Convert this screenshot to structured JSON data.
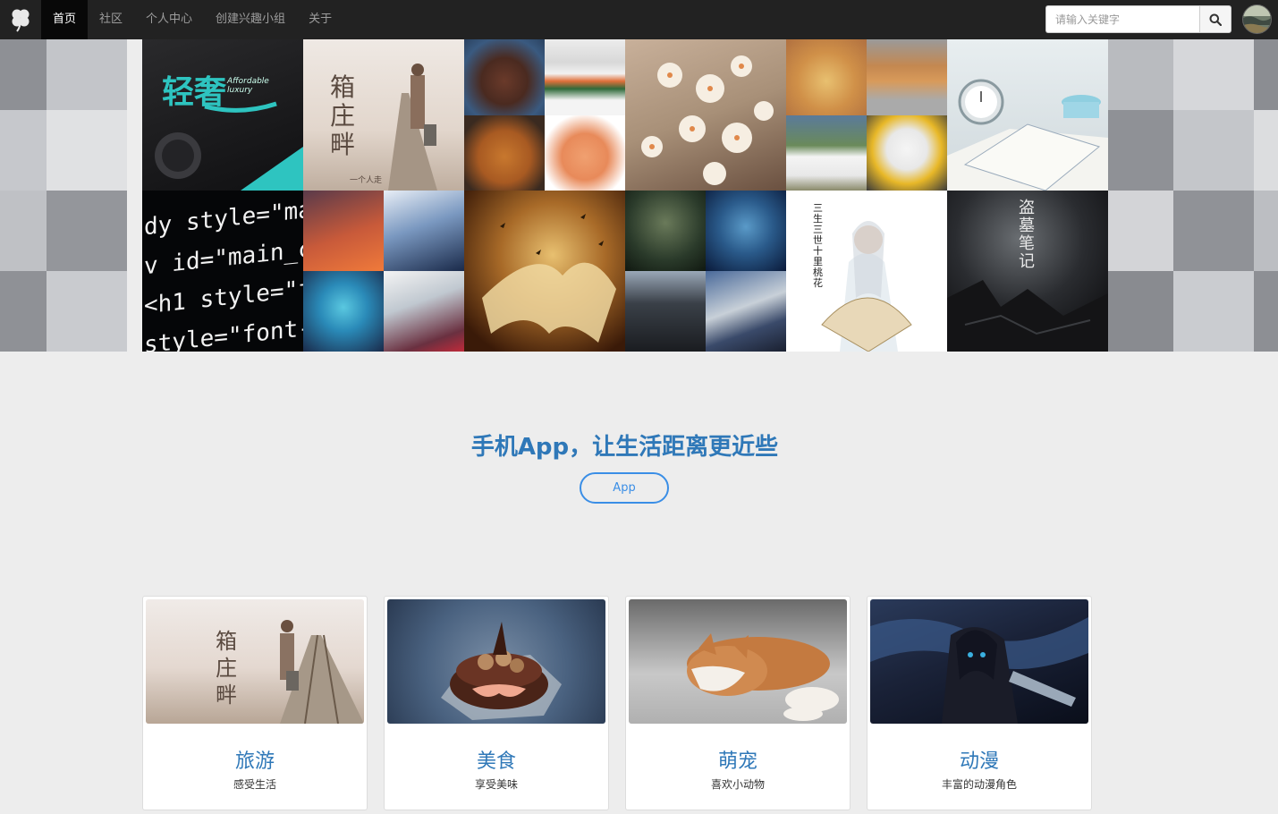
{
  "nav": {
    "brand_icon": "clover-logo-icon",
    "items": [
      {
        "label": "首页",
        "active": true
      },
      {
        "label": "社区",
        "active": false
      },
      {
        "label": "个人中心",
        "active": false
      },
      {
        "label": "创建兴趣小组",
        "active": false
      },
      {
        "label": "关于",
        "active": false
      }
    ],
    "search_placeholder": "请输入关键字",
    "search_icon": "search-icon"
  },
  "banner": {
    "tiles": [
      {
        "text": "轻奢",
        "subtext": "Affordable luxury"
      },
      {
        "text": "箱庄畔",
        "subtext": "一个人走"
      },
      {
        "text": ""
      },
      {
        "text": ""
      },
      {
        "text": ""
      },
      {
        "text": ""
      },
      {
        "text": "dy style=\"margi\nv id=\"main_conte\n<h1 style=\"font-\nstyle=\"font-"
      },
      {
        "text": ""
      },
      {
        "text": ""
      },
      {
        "text": ""
      },
      {
        "text": "三生三世 十里桃花"
      },
      {
        "text": "盗墓笔记"
      }
    ]
  },
  "promo": {
    "title": "手机App，让生活距离更近些",
    "button": "App"
  },
  "cards": [
    {
      "title": "旅游",
      "subtitle": "感受生活"
    },
    {
      "title": "美食",
      "subtitle": "享受美味"
    },
    {
      "title": "萌宠",
      "subtitle": "喜欢小动物"
    },
    {
      "title": "动漫",
      "subtitle": "丰富的动漫角色"
    }
  ],
  "colors": {
    "navbar": "#222222",
    "accent": "#2f78b8",
    "button_border": "#3a8ee6",
    "page_bg": "#ededed"
  }
}
